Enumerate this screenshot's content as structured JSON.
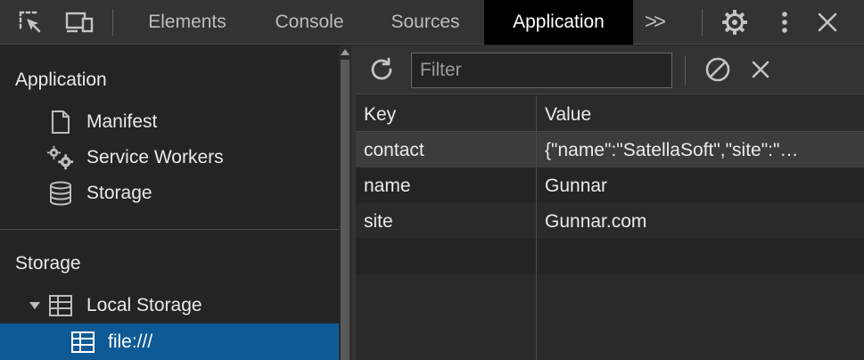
{
  "toolbar": {
    "icons": {
      "inspect": "inspect-element-icon",
      "device": "device-toolbar-icon",
      "more_tabs": "chevron-double-right-icon",
      "settings": "gear-icon",
      "menu": "kebab-menu-icon",
      "close": "close-icon"
    },
    "tabs": [
      {
        "label": "Elements"
      },
      {
        "label": "Console"
      },
      {
        "label": "Sources"
      },
      {
        "label": "Application",
        "active": true
      }
    ],
    "more_label": ">>"
  },
  "sidebar": {
    "section_application": "Application",
    "application_items": [
      {
        "label": "Manifest",
        "icon": "document-icon"
      },
      {
        "label": "Service Workers",
        "icon": "gears-icon"
      },
      {
        "label": "Storage",
        "icon": "database-icon"
      }
    ],
    "section_storage": "Storage",
    "local_storage": {
      "label": "Local Storage",
      "icon": "table-icon",
      "expanded": true
    },
    "selected_origin": {
      "label": "file:///",
      "icon": "table-icon"
    }
  },
  "filter": {
    "placeholder": "Filter",
    "value": ""
  },
  "table": {
    "columns": [
      "Key",
      "Value"
    ],
    "rows": [
      {
        "key": "contact",
        "value": "{\"name\":\"SatellaSoft\",\"site\":\"…",
        "selected": true
      },
      {
        "key": "name",
        "value": "Gunnar"
      },
      {
        "key": "site",
        "value": "Gunnar.com"
      }
    ]
  },
  "colors": {
    "toolbar_bg": "#333333",
    "panel_bg": "#242424",
    "active_tab_bg": "#000000",
    "selection_blue": "#0e5a96"
  }
}
